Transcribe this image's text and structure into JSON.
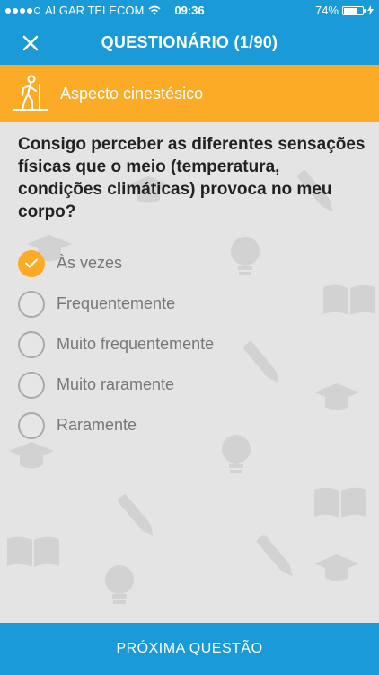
{
  "status_bar": {
    "carrier": "ALGAR TELECOM",
    "time": "09:36",
    "battery": "74%",
    "signal_dots_filled": 4,
    "signal_dots_total": 5
  },
  "header": {
    "title": "QUESTIONÁRIO (1/90)",
    "close_icon": "close-icon",
    "color": "#1a9ad6"
  },
  "aspect": {
    "label": "Aspecto cinestésico",
    "icon": "hiker-icon",
    "color": "#fbab25"
  },
  "question": {
    "text": "Consigo perceber as diferentes sensações físicas que o meio (temperatura, condições climáticas) provoca no meu corpo?"
  },
  "options": [
    {
      "label": "Às vezes",
      "selected": true
    },
    {
      "label": "Frequentemente",
      "selected": false
    },
    {
      "label": "Muito frequentemente",
      "selected": false
    },
    {
      "label": "Muito raramente",
      "selected": false
    },
    {
      "label": "Raramente",
      "selected": false
    }
  ],
  "footer": {
    "next_label": "PRÓXIMA QUESTÃO"
  },
  "background_icons": [
    "graduation-cap-icon",
    "lightbulb-icon",
    "book-icon",
    "pencil-icon"
  ]
}
